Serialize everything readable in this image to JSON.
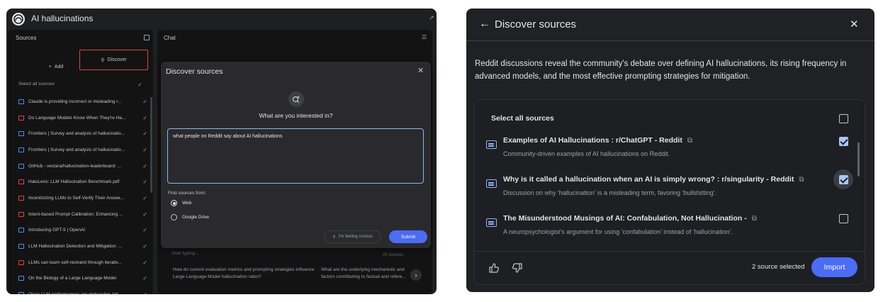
{
  "left": {
    "app_title": "AI hallucinations",
    "sources": {
      "title": "Sources",
      "add_label": "Add",
      "discover_label": "Discover",
      "select_all_label": "Select all sources",
      "items": [
        {
          "label": "Claude is providing incorrect or misleading r...",
          "icon": "doc-icon",
          "color": "#4f8cf7"
        },
        {
          "label": "Do Language Models Know When They're Ha...",
          "icon": "pdf-icon",
          "color": "#e5413a"
        },
        {
          "label": "Frontiers | Survey and analysis of hallucinatio...",
          "icon": "web-icon",
          "color": "#4f8cf7"
        },
        {
          "label": "Frontiers | Survey and analysis of hallucinatio...",
          "icon": "web-icon",
          "color": "#4f8cf7"
        },
        {
          "label": "GitHub - vectara/hallucination-leaderboard: ...",
          "icon": "web-icon",
          "color": "#4f8cf7"
        },
        {
          "label": "HaluLens: LLM Hallucination Benchmark.pdf",
          "icon": "pdf-icon",
          "color": "#e5413a"
        },
        {
          "label": "Incentivizing LLMs to Self-Verify Their Answe...",
          "icon": "pdf-icon",
          "color": "#e5413a"
        },
        {
          "label": "Intent-based Prompt Calibration: Enhancing ...",
          "icon": "pdf-icon",
          "color": "#e5413a"
        },
        {
          "label": "Introducing GPT-5 | OpenAI",
          "icon": "web-icon",
          "color": "#4f8cf7"
        },
        {
          "label": "LLM Hallucination Detection and Mitigation: ...",
          "icon": "web-icon",
          "color": "#4f8cf7"
        },
        {
          "label": "LLMs can learn self-restraint through iterativ...",
          "icon": "pdf-icon",
          "color": "#e5413a"
        },
        {
          "label": "On the Biology of a Large Language Model",
          "icon": "web-icon",
          "color": "#4f8cf7"
        },
        {
          "label": "Open-LLM performances are plateauing, let'...",
          "icon": "web-icon",
          "color": "#4f8cf7"
        }
      ]
    },
    "chat": {
      "title": "Chat",
      "input_placeholder": "Start typing...",
      "source_count": "20 sources",
      "suggestions": [
        "How do current evaluation metrics and prompting strategies influence Large Language Model hallucination rates?",
        "What are the underlying mechanistic and factors contributing to factual and refere..."
      ]
    },
    "discover_modal": {
      "title": "Discover sources",
      "question": "What are you interested in?",
      "query": "what people on Reddit say about AI hallucinations",
      "find_from_label": "Find sources from:",
      "options": [
        "Web",
        "Google Drive"
      ],
      "selected_option": "Web",
      "curious_label": "I'm feeling curious",
      "submit_label": "Submit"
    }
  },
  "right": {
    "title": "Discover sources",
    "summary": "Reddit discussions reveal the community's debate over defining AI hallucinations, its rising frequency in advanced models, and the most effective prompting strategies for mitigation.",
    "select_all_label": "Select all sources",
    "select_all_checked": false,
    "results": [
      {
        "title": "Examples of AI Hallucinations : r/ChatGPT - Reddit",
        "desc": "Community-driven examples of AI hallucinations on Reddit.",
        "checked": true
      },
      {
        "title": "Why is it called a hallucination when an AI is simply wrong? : r/singularity - Reddit",
        "desc": "Discussion on why 'hallucination' is a misleading term, favoring 'bullshitting'.",
        "checked": true
      },
      {
        "title": "The Misunderstood Musings of AI: Confabulation, Not Hallucination -",
        "desc": "A neuropsychologist's argument for using 'confabulation' instead of 'hallucination'.",
        "checked": false
      }
    ],
    "selected_count_label": "2 source selected",
    "import_label": "Import"
  },
  "colors": {
    "accent_blue": "#4a6cf7",
    "highlight_red": "#e5413a",
    "check_blue": "#a8c7fa"
  }
}
